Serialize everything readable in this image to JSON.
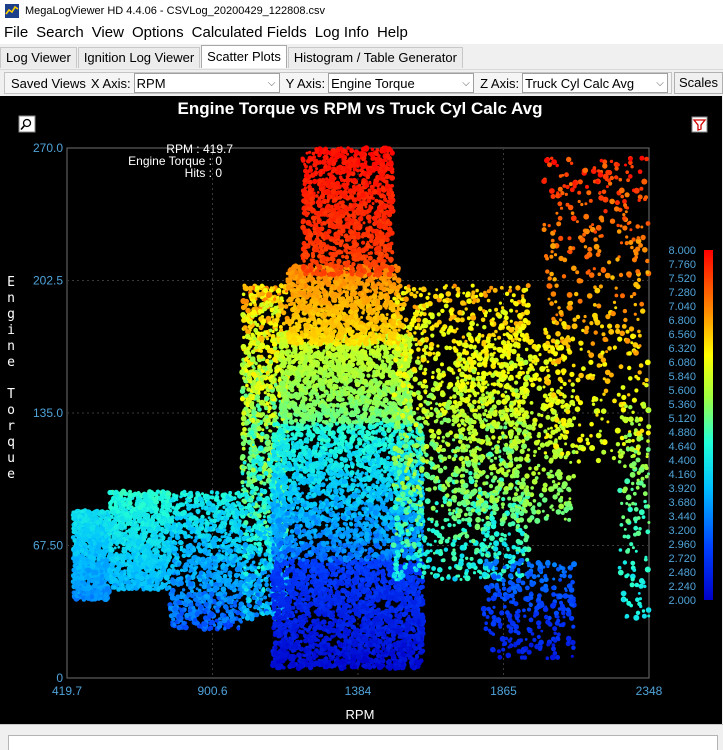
{
  "window": {
    "title": "MegaLogViewer HD 4.4.06 - CSVLog_20200429_122808.csv"
  },
  "menu": [
    "File",
    "Search",
    "View",
    "Options",
    "Calculated Fields",
    "Log Info",
    "Help"
  ],
  "tabs": [
    {
      "label": "Log Viewer",
      "active": false
    },
    {
      "label": "Ignition Log Viewer",
      "active": false
    },
    {
      "label": "Scatter Plots",
      "active": true
    },
    {
      "label": "Histogram / Table Generator",
      "active": false
    }
  ],
  "toolbar": {
    "saved_views_label": "Saved Views",
    "x_axis_label": "X Axis:",
    "x_axis_value": "RPM",
    "y_axis_label": "Y Axis:",
    "y_axis_value": "Engine Torque",
    "z_axis_label": "Z Axis:",
    "z_axis_value": "Truck Cyl Calc Avg",
    "scales_label": "Scales"
  },
  "readout": {
    "rpm": "RPM : 419.7",
    "torque": "Engine Torque : 0",
    "hits": "Hits : 0"
  },
  "chart_data": {
    "type": "scatter",
    "title": "Engine Torque vs RPM vs Truck Cyl Calc Avg",
    "xlabel": "RPM",
    "ylabel": "Engine Torque",
    "xlim": [
      419.7,
      2348
    ],
    "ylim": [
      0,
      270.0
    ],
    "x_ticks": [
      "419.7",
      "900.6",
      "1384",
      "1865",
      "2348"
    ],
    "y_ticks": [
      "0",
      "67.50",
      "135.0",
      "202.5",
      "270.0"
    ],
    "colorbar": {
      "zlim": [
        2.0,
        8.0
      ],
      "labels": [
        "8.000",
        "7.760",
        "7.520",
        "7.280",
        "7.040",
        "6.800",
        "6.560",
        "6.320",
        "6.080",
        "5.840",
        "5.600",
        "5.360",
        "5.120",
        "4.880",
        "4.640",
        "4.400",
        "4.160",
        "3.920",
        "3.680",
        "3.440",
        "3.200",
        "2.960",
        "2.720",
        "2.480",
        "2.240",
        "2.000"
      ]
    },
    "grid": true,
    "colors": {
      "background": "#000000",
      "axis": "#7a7a7a",
      "tick_label": "#4fa3d9",
      "title": "#ffffff"
    },
    "density_regions": [
      {
        "x": [
          440,
          560
        ],
        "y": [
          40,
          85
        ],
        "z": [
          3.3,
          4.5
        ],
        "n": 900
      },
      {
        "x": [
          560,
          760
        ],
        "y": [
          45,
          95
        ],
        "z": [
          3.6,
          4.9
        ],
        "n": 1000
      },
      {
        "x": [
          760,
          1000
        ],
        "y": [
          25,
          95
        ],
        "z": [
          2.8,
          4.8
        ],
        "n": 900
      },
      {
        "x": [
          1000,
          1150
        ],
        "y": [
          30,
          200
        ],
        "z": [
          3.0,
          7.2
        ],
        "n": 1400
      },
      {
        "x": [
          1100,
          1600
        ],
        "y": [
          5,
          60
        ],
        "z": [
          2.0,
          3.0
        ],
        "n": 2000
      },
      {
        "x": [
          1100,
          1600
        ],
        "y": [
          60,
          130
        ],
        "z": [
          3.0,
          5.0
        ],
        "n": 2000
      },
      {
        "x": [
          1130,
          1560
        ],
        "y": [
          130,
          175
        ],
        "z": [
          5.0,
          6.0
        ],
        "n": 1400
      },
      {
        "x": [
          1150,
          1520
        ],
        "y": [
          170,
          210
        ],
        "z": [
          6.3,
          7.1
        ],
        "n": 1100
      },
      {
        "x": [
          1200,
          1500
        ],
        "y": [
          205,
          270
        ],
        "z": [
          7.4,
          8.0
        ],
        "n": 1100
      },
      {
        "x": [
          1500,
          1950
        ],
        "y": [
          50,
          200
        ],
        "z": [
          4.0,
          7.0
        ],
        "n": 1400
      },
      {
        "x": [
          1700,
          2100
        ],
        "y": [
          80,
          175
        ],
        "z": [
          5.0,
          6.5
        ],
        "n": 600
      },
      {
        "x": [
          1800,
          2100
        ],
        "y": [
          10,
          60
        ],
        "z": [
          2.2,
          3.5
        ],
        "n": 300
      },
      {
        "x": [
          2000,
          2348
        ],
        "y": [
          110,
          265
        ],
        "z": [
          5.5,
          8.0
        ],
        "n": 500
      },
      {
        "x": [
          2250,
          2348
        ],
        "y": [
          30,
          140
        ],
        "z": [
          4.0,
          6.0
        ],
        "n": 140
      }
    ]
  }
}
